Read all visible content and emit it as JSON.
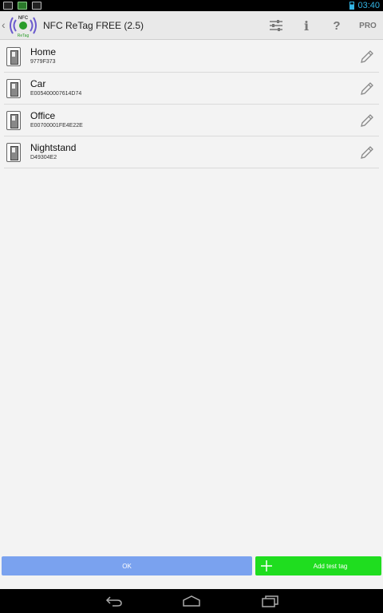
{
  "status_bar": {
    "time": "03:40",
    "left_icons": [
      "gallery-icon",
      "android-icon",
      "usb-icon"
    ],
    "right_icons": [
      "battery-icon"
    ]
  },
  "action_bar": {
    "logo_text_top": "NFC",
    "logo_text_bottom": "ReTag",
    "title": "NFC ReTag FREE (2.5)",
    "icons": [
      "settings-sliders-icon",
      "info-icon",
      "help-icon"
    ],
    "info_label": "i",
    "help_label": "?",
    "pro_label": "PRO"
  },
  "tags": [
    {
      "name": "Home",
      "id": "9779F373"
    },
    {
      "name": "Car",
      "id": "E005400007614D74"
    },
    {
      "name": "Office",
      "id": "E00700001FE4E22E"
    },
    {
      "name": "Nightstand",
      "id": "D49304E2"
    }
  ],
  "buttons": {
    "ok_label": "OK",
    "add_label": "Add test tag"
  },
  "colors": {
    "accent_blue": "#7aa2ef",
    "accent_green": "#1fdd1f",
    "status_blue": "#33b5e5",
    "logo_purple": "#6a5acd"
  },
  "nav_bar": {
    "icons": [
      "back-icon",
      "home-icon",
      "recent-apps-icon"
    ]
  }
}
